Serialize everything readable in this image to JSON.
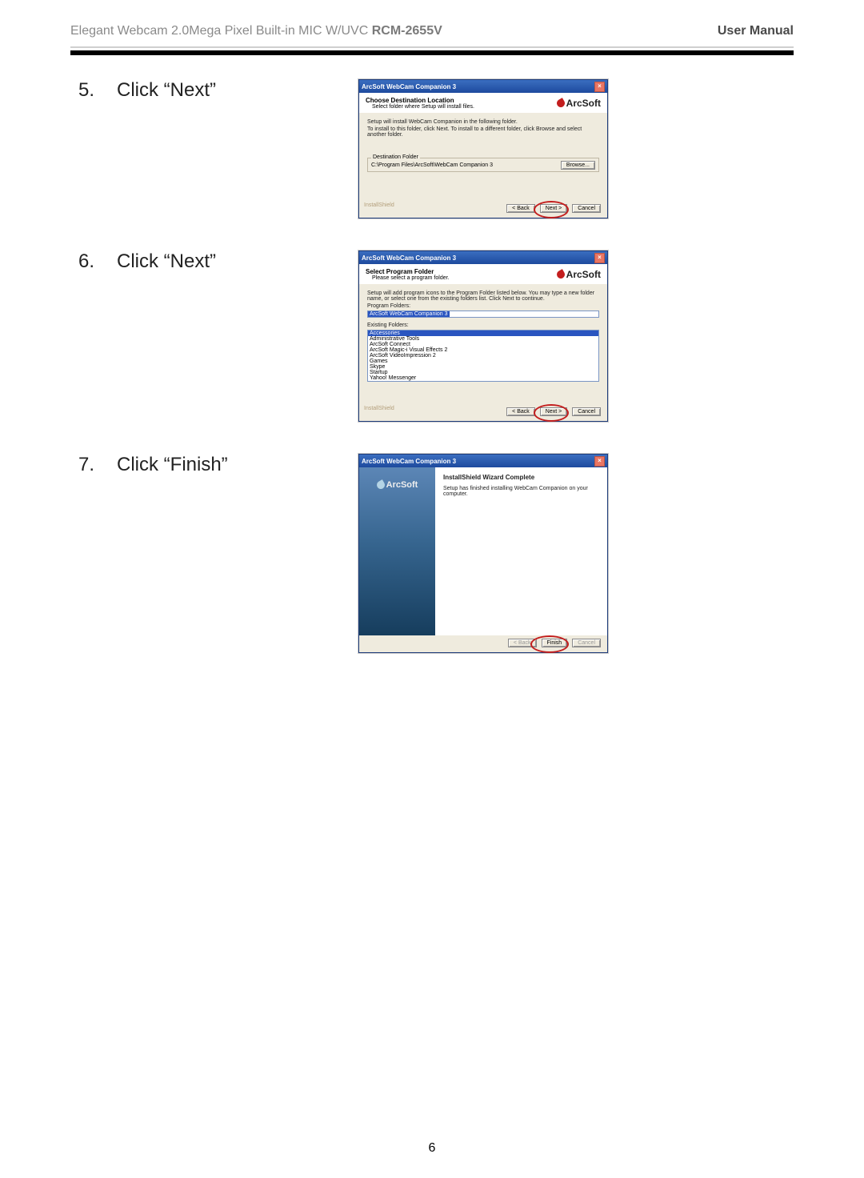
{
  "header": {
    "product_line": "Elegant Webcam 2.0Mega Pixel Built-in MIC W/UVC ",
    "model": "RCM-2655V",
    "right": "User Manual"
  },
  "page_number": "6",
  "brand": "ArcSoft",
  "steps": [
    {
      "num": "5.",
      "text": "Click “Next”"
    },
    {
      "num": "6.",
      "text": "Click “Next”"
    },
    {
      "num": "7.",
      "text": "Click “Finish”"
    }
  ],
  "dlg1": {
    "title": "ArcSoft WebCam Companion 3",
    "head_bold": "Choose Destination Location",
    "head_sub": "Select folder where Setup will install files.",
    "body1": "Setup will install WebCam Companion in the following folder.",
    "body2": "To install to this folder, click Next. To install to a different folder, click Browse and select another folder.",
    "legend": "Destination Folder",
    "path": "C:\\Program Files\\ArcSoft\\WebCam Companion 3",
    "browse": "Browse...",
    "back": "< Back",
    "next": "Next >",
    "cancel": "Cancel",
    "brand_faded": "InstallShield"
  },
  "dlg2": {
    "title": "ArcSoft WebCam Companion 3",
    "head_bold": "Select Program Folder",
    "head_sub": "Please select a program folder.",
    "body": "Setup will add program icons to the Program Folder listed below.  You may type a new folder name, or select one from the existing folders list.  Click Next to continue.",
    "label_pf": "Program Folders:",
    "pf_value": "ArcSoft WebCam Companion 3",
    "label_ef": "Existing Folders:",
    "ef_items": [
      "Accessories",
      "Administrative Tools",
      "ArcSoft Connect",
      "ArcSoft Magic-i Visual Effects 2",
      "ArcSoft VideoImpression 2",
      "Games",
      "Skype",
      "Startup",
      "Yahoo! Messenger"
    ],
    "back": "< Back",
    "next": "Next >",
    "cancel": "Cancel",
    "brand_faded": "InstallShield"
  },
  "dlg3": {
    "title": "ArcSoft WebCam Companion 3",
    "head_bold": "InstallShield Wizard Complete",
    "body": "Setup has finished installing WebCam Companion on your computer.",
    "back": "< Back",
    "finish": "Finish",
    "cancel": "Cancel"
  }
}
